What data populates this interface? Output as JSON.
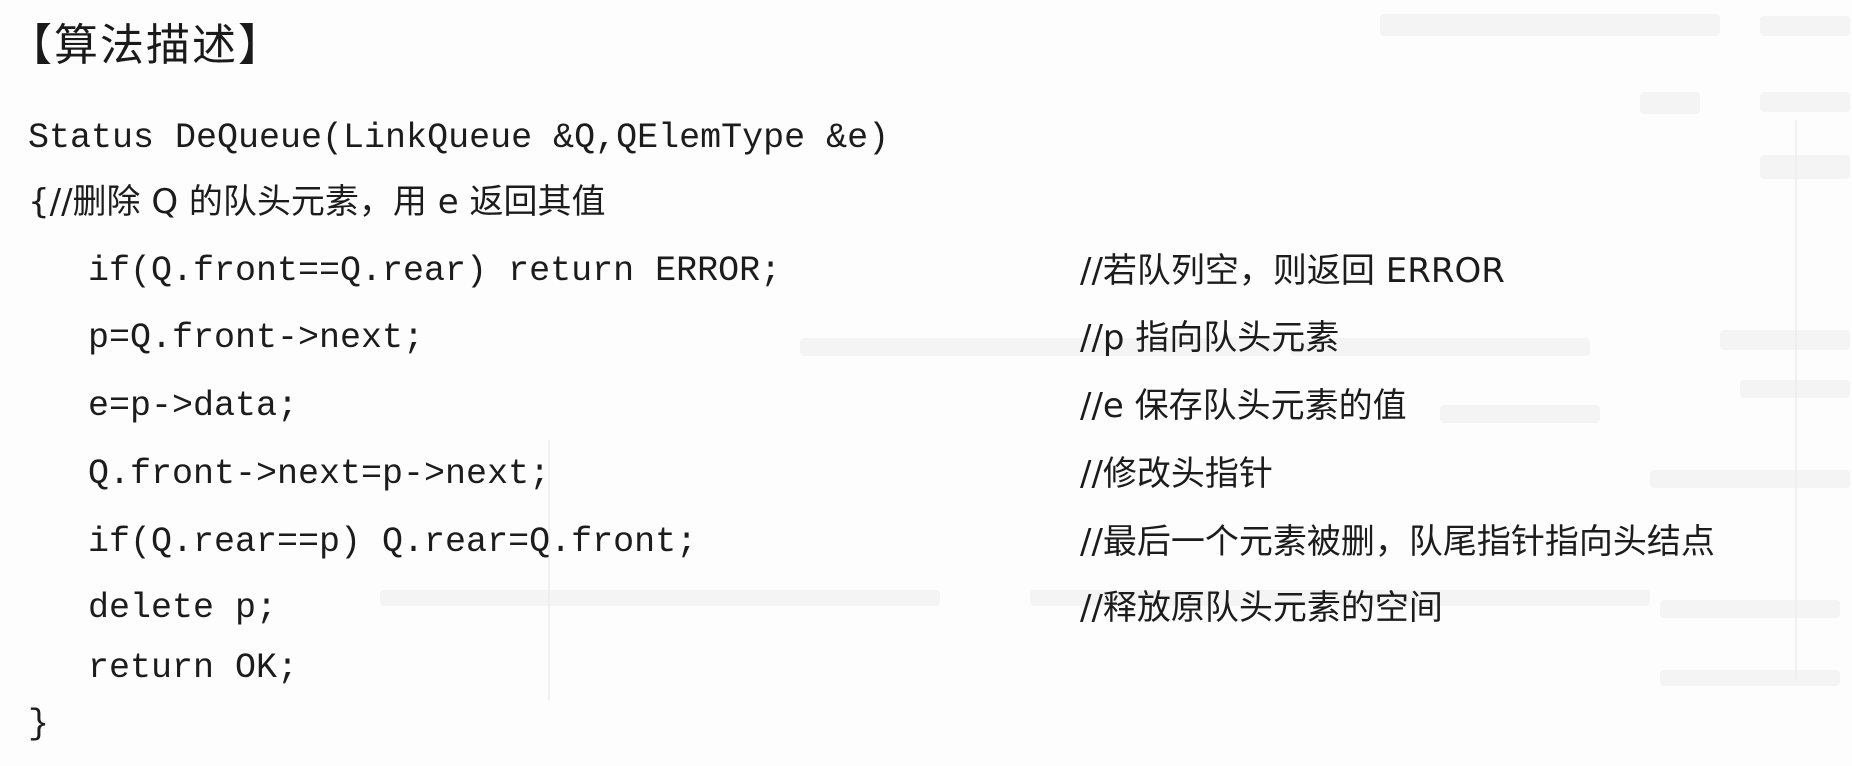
{
  "heading": "【算法描述】",
  "code": {
    "signature": "Status DeQueue(LinkQueue &Q,QElemType &e)",
    "open_comment": "{//删除 Q 的队头元素，用 e 返回其值",
    "lines": [
      {
        "code": "if(Q.front==Q.rear) return ERROR;",
        "comment": "//若队列空，则返回 ERROR"
      },
      {
        "code": "p=Q.front->next;",
        "comment": "//p 指向队头元素"
      },
      {
        "code": "e=p->data;",
        "comment": "//e 保存队头元素的值"
      },
      {
        "code": "Q.front->next=p->next;",
        "comment": "//修改头指针"
      },
      {
        "code": "if(Q.rear==p) Q.rear=Q.front;",
        "comment": "//最后一个元素被删，队尾指针指向头结点"
      },
      {
        "code": "delete p;",
        "comment": "//释放原队头元素的空间"
      },
      {
        "code": "return OK;",
        "comment": ""
      }
    ],
    "closing": "}"
  }
}
